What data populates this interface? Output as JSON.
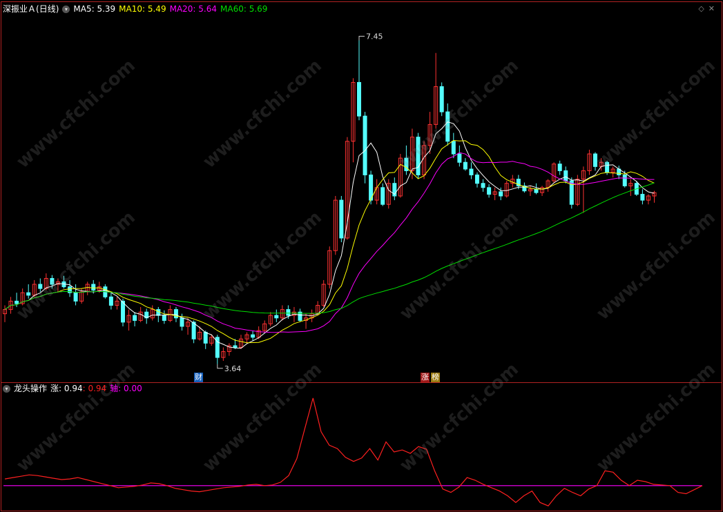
{
  "stock": {
    "name": "深振业Ａ",
    "period": "(日线)"
  },
  "main_legend": [
    {
      "label": "MA5: 5.39",
      "color": "#ffffff"
    },
    {
      "label": "MA10: 5.49",
      "color": "#ffff00"
    },
    {
      "label": "MA20: 5.64",
      "color": "#ff00ff"
    },
    {
      "label": "MA60: 5.69",
      "color": "#00e000"
    }
  ],
  "sub_indicator": {
    "name": "龙头操作",
    "zhang_label": "涨: 0.94",
    "sep_label": ": 0.94",
    "axis_label": "轴: 0.00",
    "zhang_color": "#ff2020",
    "axis_color": "#ff00ff"
  },
  "annotations": {
    "high_price": "7.45",
    "low_price": "3.64",
    "tag_cai": "财",
    "tag_zhang": "涨",
    "tag_bang": "榜"
  },
  "watermark": "www.cfchi.com",
  "colors": {
    "up": "#ff3232",
    "down": "#54ffff",
    "ma5": "#ffffff",
    "ma10": "#ffff00",
    "ma20": "#ff00ff",
    "ma60": "#00e000",
    "frame": "#b22222"
  },
  "chart_data": {
    "type": "candlestick",
    "price_range": [
      3.5,
      7.7
    ],
    "candles": [
      [
        4.2,
        4.3,
        4.1,
        4.25
      ],
      [
        4.25,
        4.4,
        4.2,
        4.35
      ],
      [
        4.35,
        4.45,
        4.28,
        4.32
      ],
      [
        4.32,
        4.5,
        4.3,
        4.45
      ],
      [
        4.45,
        4.55,
        4.38,
        4.42
      ],
      [
        4.42,
        4.6,
        4.4,
        4.55
      ],
      [
        4.55,
        4.62,
        4.46,
        4.5
      ],
      [
        4.5,
        4.68,
        4.48,
        4.62
      ],
      [
        4.62,
        4.66,
        4.5,
        4.55
      ],
      [
        4.55,
        4.62,
        4.45,
        4.58
      ],
      [
        4.58,
        4.65,
        4.5,
        4.52
      ],
      [
        4.52,
        4.6,
        4.4,
        4.45
      ],
      [
        4.45,
        4.55,
        4.3,
        4.35
      ],
      [
        4.35,
        4.5,
        4.32,
        4.46
      ],
      [
        4.46,
        4.58,
        4.42,
        4.55
      ],
      [
        4.55,
        4.6,
        4.44,
        4.48
      ],
      [
        4.48,
        4.58,
        4.45,
        4.52
      ],
      [
        4.52,
        4.55,
        4.38,
        4.4
      ],
      [
        4.4,
        4.45,
        4.25,
        4.3
      ],
      [
        4.3,
        4.4,
        4.25,
        4.35
      ],
      [
        4.35,
        4.38,
        4.05,
        4.1
      ],
      [
        4.1,
        4.25,
        4.0,
        4.18
      ],
      [
        4.18,
        4.22,
        4.05,
        4.12
      ],
      [
        4.12,
        4.28,
        4.1,
        4.22
      ],
      [
        4.22,
        4.26,
        4.08,
        4.15
      ],
      [
        4.15,
        4.3,
        4.12,
        4.25
      ],
      [
        4.25,
        4.28,
        4.1,
        4.18
      ],
      [
        4.18,
        4.24,
        4.08,
        4.12
      ],
      [
        4.12,
        4.3,
        4.1,
        4.25
      ],
      [
        4.25,
        4.28,
        4.1,
        4.15
      ],
      [
        4.15,
        4.2,
        4.0,
        4.05
      ],
      [
        4.05,
        4.15,
        3.95,
        4.1
      ],
      [
        4.1,
        4.12,
        3.85,
        3.9
      ],
      [
        3.9,
        4.05,
        3.88,
        3.98
      ],
      [
        3.98,
        4.0,
        3.78,
        3.85
      ],
      [
        3.85,
        3.95,
        3.82,
        3.92
      ],
      [
        3.92,
        3.95,
        3.6,
        3.68
      ],
      [
        3.68,
        3.8,
        3.64,
        3.75
      ],
      [
        3.75,
        3.85,
        3.7,
        3.82
      ],
      [
        3.82,
        3.9,
        3.78,
        3.8
      ],
      [
        3.8,
        3.95,
        3.78,
        3.9
      ],
      [
        3.9,
        3.98,
        3.85,
        3.95
      ],
      [
        3.95,
        4.0,
        3.88,
        3.92
      ],
      [
        3.92,
        4.05,
        3.9,
        4.0
      ],
      [
        4.0,
        4.12,
        3.98,
        4.08
      ],
      [
        4.08,
        4.22,
        4.05,
        4.18
      ],
      [
        4.18,
        4.25,
        4.1,
        4.15
      ],
      [
        4.15,
        4.3,
        4.12,
        4.25
      ],
      [
        4.25,
        4.3,
        4.14,
        4.18
      ],
      [
        4.18,
        4.28,
        4.1,
        4.22
      ],
      [
        4.22,
        4.26,
        4.1,
        4.12
      ],
      [
        4.12,
        4.2,
        4.02,
        4.15
      ],
      [
        4.15,
        4.25,
        4.1,
        4.2
      ],
      [
        4.2,
        4.35,
        4.18,
        4.3
      ],
      [
        4.3,
        4.6,
        4.28,
        4.55
      ],
      [
        4.55,
        5.0,
        4.5,
        4.95
      ],
      [
        4.95,
        5.6,
        4.9,
        5.55
      ],
      [
        5.55,
        5.6,
        5.05,
        5.1
      ],
      [
        5.1,
        6.3,
        5.08,
        6.25
      ],
      [
        6.25,
        7.0,
        6.0,
        6.95
      ],
      [
        6.95,
        7.45,
        6.5,
        6.55
      ],
      [
        6.55,
        6.6,
        5.75,
        5.85
      ],
      [
        5.85,
        5.9,
        5.5,
        5.55
      ],
      [
        5.55,
        5.8,
        5.5,
        5.7
      ],
      [
        5.7,
        5.75,
        5.48,
        5.5
      ],
      [
        5.5,
        5.8,
        5.45,
        5.75
      ],
      [
        5.75,
        5.82,
        5.55,
        5.6
      ],
      [
        5.6,
        6.1,
        5.58,
        6.05
      ],
      [
        6.05,
        6.2,
        5.85,
        5.9
      ],
      [
        5.9,
        6.4,
        5.8,
        6.3
      ],
      [
        6.3,
        6.35,
        5.8,
        5.85
      ],
      [
        5.85,
        6.25,
        5.8,
        6.2
      ],
      [
        6.2,
        6.6,
        6.1,
        6.45
      ],
      [
        6.45,
        7.3,
        6.4,
        6.9
      ],
      [
        6.9,
        6.95,
        6.55,
        6.6
      ],
      [
        6.6,
        6.7,
        6.2,
        6.25
      ],
      [
        6.25,
        6.35,
        6.05,
        6.1
      ],
      [
        6.1,
        6.2,
        5.95,
        6.0
      ],
      [
        6.0,
        6.05,
        5.9,
        5.92
      ],
      [
        5.92,
        6.0,
        5.8,
        5.85
      ],
      [
        5.85,
        5.88,
        5.7,
        5.75
      ],
      [
        5.75,
        5.8,
        5.65,
        5.7
      ],
      [
        5.7,
        5.74,
        5.58,
        5.62
      ],
      [
        5.62,
        5.7,
        5.55,
        5.65
      ],
      [
        5.65,
        5.7,
        5.55,
        5.6
      ],
      [
        5.6,
        5.78,
        5.58,
        5.75
      ],
      [
        5.75,
        5.85,
        5.7,
        5.8
      ],
      [
        5.8,
        5.85,
        5.68,
        5.72
      ],
      [
        5.72,
        5.76,
        5.64,
        5.66
      ],
      [
        5.66,
        5.72,
        5.6,
        5.68
      ],
      [
        5.68,
        5.75,
        5.62,
        5.64
      ],
      [
        5.64,
        5.72,
        5.6,
        5.7
      ],
      [
        5.7,
        5.8,
        5.65,
        5.78
      ],
      [
        5.78,
        6.0,
        5.75,
        5.98
      ],
      [
        5.98,
        6.02,
        5.85,
        5.9
      ],
      [
        5.9,
        5.95,
        5.75,
        5.78
      ],
      [
        5.78,
        5.82,
        5.45,
        5.5
      ],
      [
        5.5,
        5.85,
        5.48,
        5.8
      ],
      [
        5.8,
        5.95,
        5.4,
        5.9
      ],
      [
        5.9,
        6.15,
        5.85,
        6.1
      ],
      [
        6.1,
        6.12,
        5.9,
        5.95
      ],
      [
        5.95,
        6.05,
        5.9,
        6.0
      ],
      [
        6.0,
        6.02,
        5.85,
        5.88
      ],
      [
        5.88,
        5.95,
        5.82,
        5.92
      ],
      [
        5.92,
        5.96,
        5.8,
        5.85
      ],
      [
        5.85,
        5.9,
        5.7,
        5.72
      ],
      [
        5.72,
        5.8,
        5.6,
        5.75
      ],
      [
        5.75,
        5.78,
        5.6,
        5.62
      ],
      [
        5.62,
        5.68,
        5.5,
        5.55
      ],
      [
        5.55,
        5.62,
        5.5,
        5.6
      ],
      [
        5.6,
        5.66,
        5.52,
        5.64
      ]
    ],
    "sub_values": [
      1.0,
      1.2,
      1.4,
      1.6,
      1.5,
      1.3,
      1.1,
      0.9,
      1.0,
      1.2,
      0.9,
      0.6,
      0.3,
      0.0,
      -0.3,
      -0.2,
      -0.1,
      0.1,
      0.4,
      0.3,
      0.0,
      -0.4,
      -0.6,
      -0.8,
      -0.9,
      -0.7,
      -0.5,
      -0.3,
      -0.2,
      -0.1,
      0.1,
      0.2,
      0.0,
      0.1,
      0.5,
      1.5,
      4.0,
      8.5,
      13.0,
      8.0,
      6.0,
      5.5,
      4.2,
      3.6,
      4.1,
      5.5,
      3.8,
      6.5,
      5.0,
      5.3,
      4.8,
      5.8,
      5.4,
      2.2,
      -0.5,
      -1.0,
      -0.2,
      1.2,
      0.8,
      0.2,
      -0.3,
      -0.8,
      -1.5,
      -2.5,
      -1.5,
      -0.8,
      -2.5,
      -3.0,
      -1.5,
      -0.4,
      -1.0,
      -1.5,
      -0.5,
      0.0,
      2.2,
      2.0,
      0.8,
      0.0,
      0.8,
      0.6,
      0.2,
      0.1,
      0.0,
      -1.0,
      -1.2,
      -0.6,
      0.0
    ],
    "sub_range": [
      -3.5,
      13.5
    ],
    "axis_value": 0
  }
}
